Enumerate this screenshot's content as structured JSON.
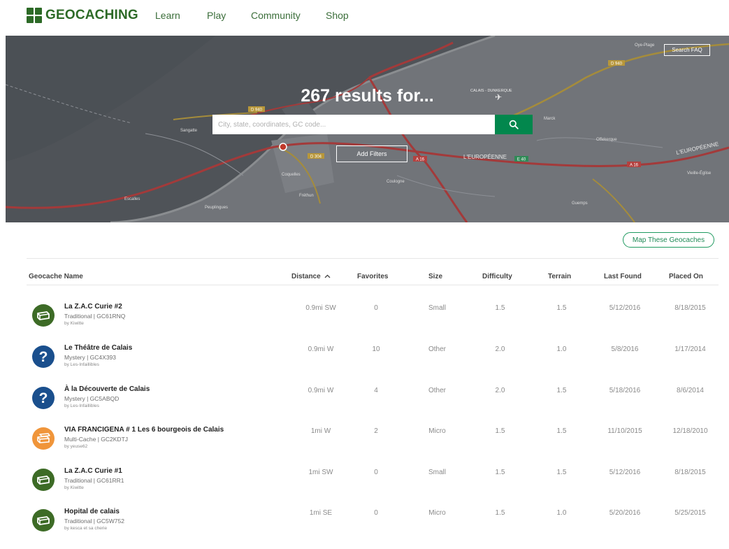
{
  "nav": {
    "logo": "GEOCACHING",
    "links": [
      "Learn",
      "Play",
      "Community",
      "Shop"
    ]
  },
  "hero": {
    "title": "267 results for...",
    "search_placeholder": "City, state, coordinates, GC code...",
    "add_filters": "Add Filters",
    "search_faq": "Search FAQ",
    "map_labels": [
      "D 940",
      "D 940",
      "D 304",
      "A 16",
      "A 16",
      "E 40",
      "L'EUROPÉENNE",
      "L'EUROPÉENNE",
      "CALAIS - DUNKERQUE",
      "Oye-Plage",
      "Sangatte",
      "Coquelles",
      "Peuplingues",
      "Escalles",
      "Fréthun",
      "Coulogne",
      "Marck",
      "Offekerque",
      "Vieille-Église",
      "Guemps"
    ]
  },
  "results": {
    "map_button": "Map These Geocaches",
    "columns": {
      "name": "Geocache Name",
      "distance": "Distance",
      "favorites": "Favorites",
      "size": "Size",
      "difficulty": "Difficulty",
      "terrain": "Terrain",
      "last_found": "Last Found",
      "placed_on": "Placed On"
    },
    "rows": [
      {
        "icon": "traditional-cache-icon",
        "name": "La Z.A.C Curie #2",
        "meta": "Traditional | GC61RNQ",
        "by": "by Kiwitte",
        "distance": "0.9mi SW",
        "favorites": "0",
        "size": "Small",
        "difficulty": "1.5",
        "terrain": "1.5",
        "last_found": "5/12/2016",
        "placed_on": "8/18/2015"
      },
      {
        "icon": "mystery-cache-icon",
        "name": "Le Théâtre de Calais",
        "meta": "Mystery | GC4X393",
        "by": "by Les-Infaillibles",
        "distance": "0.9mi W",
        "favorites": "10",
        "size": "Other",
        "difficulty": "2.0",
        "terrain": "1.0",
        "last_found": "5/8/2016",
        "placed_on": "1/17/2014"
      },
      {
        "icon": "mystery-cache-icon",
        "name": "À la Découverte de Calais",
        "meta": "Mystery | GC5ABQD",
        "by": "by Les-Infaillibles",
        "distance": "0.9mi W",
        "favorites": "4",
        "size": "Other",
        "difficulty": "2.0",
        "terrain": "1.5",
        "last_found": "5/18/2016",
        "placed_on": "8/6/2014"
      },
      {
        "icon": "multi-cache-icon",
        "name": "VIA FRANCIGENA # 1 Les 6 bourgeois de Calais",
        "meta": "Multi-Cache | GC2KDTJ",
        "by": "by yeuse62",
        "distance": "1mi W",
        "favorites": "2",
        "size": "Micro",
        "difficulty": "1.5",
        "terrain": "1.5",
        "last_found": "11/10/2015",
        "placed_on": "12/18/2010"
      },
      {
        "icon": "traditional-cache-icon",
        "name": "La Z.A.C Curie #1",
        "meta": "Traditional | GC61RR1",
        "by": "by Kiwitte",
        "distance": "1mi SW",
        "favorites": "0",
        "size": "Small",
        "difficulty": "1.5",
        "terrain": "1.5",
        "last_found": "5/12/2016",
        "placed_on": "8/18/2015"
      },
      {
        "icon": "traditional-cache-icon",
        "name": "Hopital de calais",
        "meta": "Traditional | GC5W752",
        "by": "by kesca et sa cherie",
        "distance": "1mi SE",
        "favorites": "0",
        "size": "Micro",
        "difficulty": "1.5",
        "terrain": "1.0",
        "last_found": "5/20/2016",
        "placed_on": "5/25/2015"
      }
    ]
  },
  "colors": {
    "brand_green": "#2d6a27",
    "search_green": "#02874d",
    "traditional": "#3d6b26",
    "mystery": "#1a4f8d",
    "multi": "#f0953a"
  }
}
